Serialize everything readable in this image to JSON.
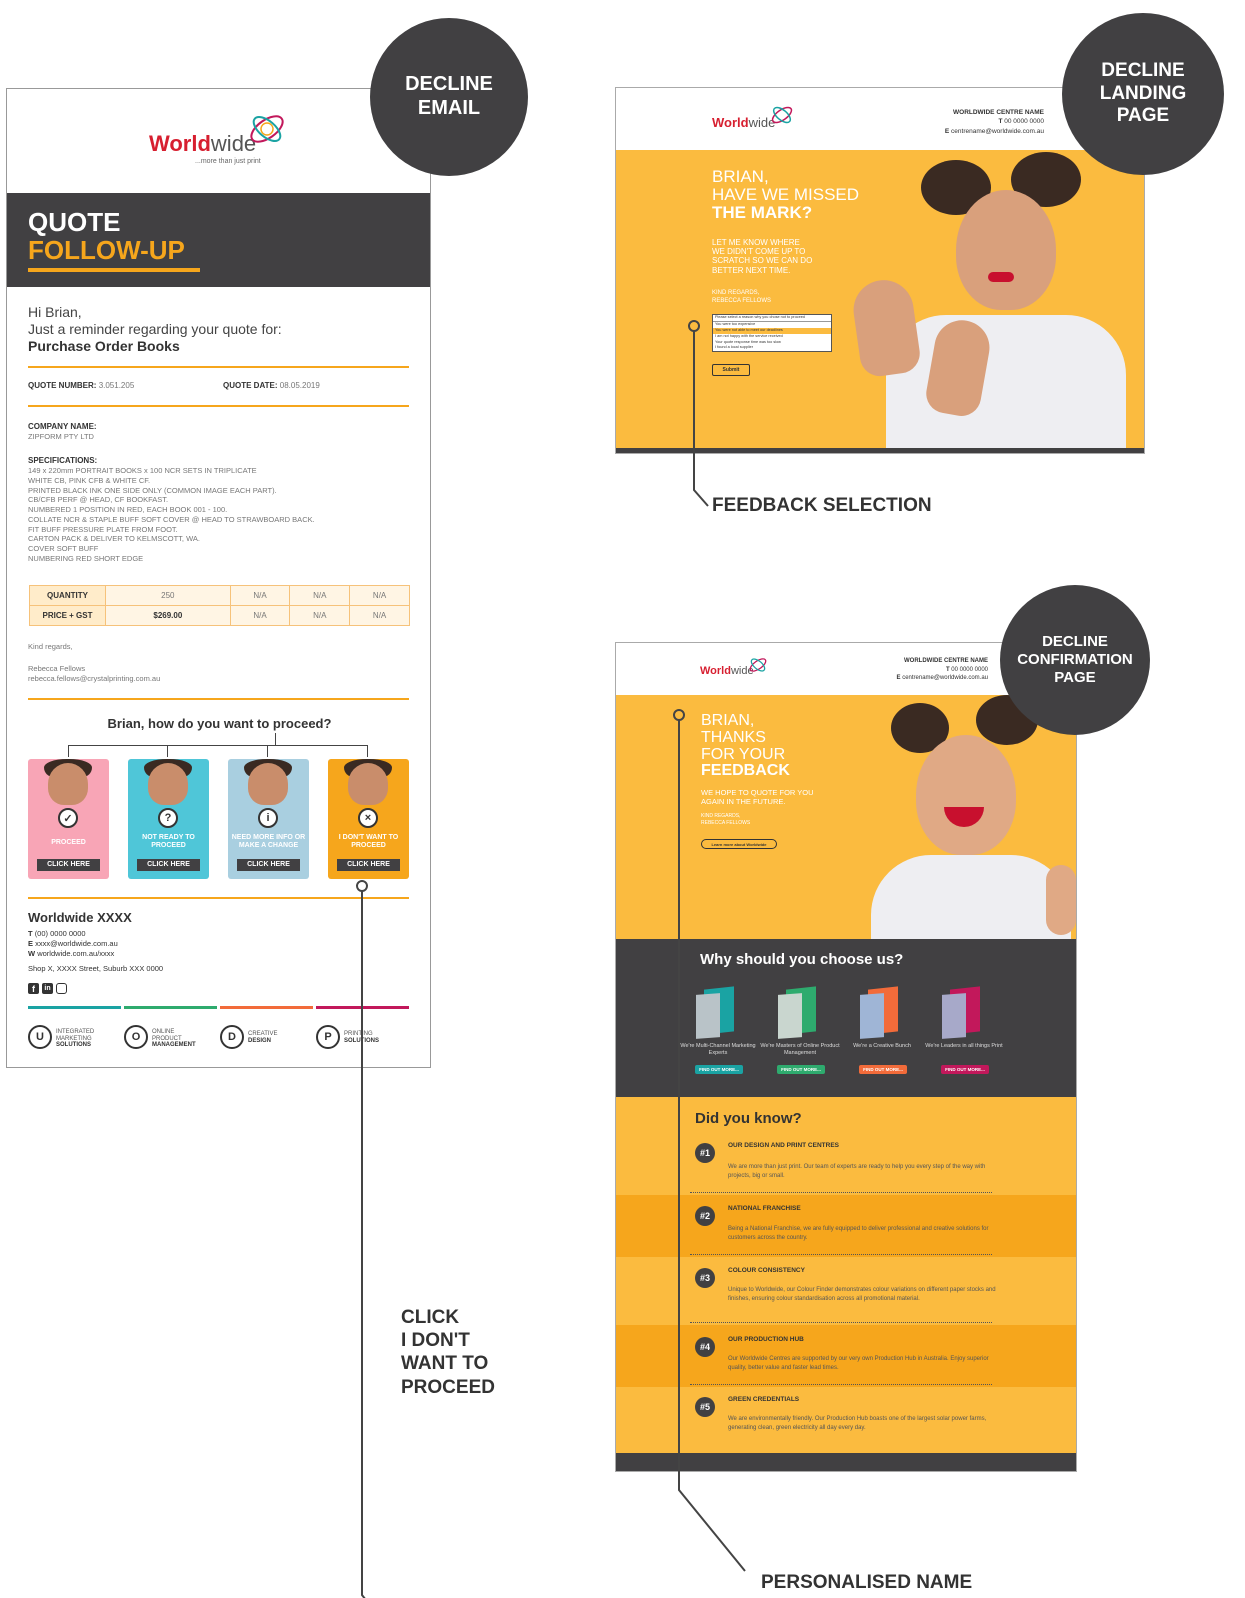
{
  "badges": {
    "email": [
      "DECLINE",
      "EMAIL"
    ],
    "landing": [
      "DECLINE",
      "LANDING",
      "PAGE"
    ],
    "confirm": [
      "DECLINE",
      "CONFIRMATION",
      "PAGE"
    ]
  },
  "callouts": {
    "feedback": "FEEDBACK SELECTION",
    "click": [
      "CLICK",
      "I DON'T",
      "WANT TO",
      "PROCEED"
    ],
    "name": "PERSONALISED NAME"
  },
  "logo": {
    "part1": "World",
    "part2": "wide",
    "tagline": "...more than just print"
  },
  "email": {
    "title1": "QUOTE",
    "title2": "FOLLOW-UP",
    "greeting": "Hi Brian,",
    "reminder": "Just a reminder regarding your quote for:",
    "product": "Purchase Order Books",
    "quote_number_label": "QUOTE NUMBER:",
    "quote_number": "3.051.205",
    "quote_date_label": "QUOTE DATE:",
    "quote_date": "08.05.2019",
    "company_label": "COMPANY NAME:",
    "company": "ZIPFORM PTY LTD",
    "spec_label": "SPECIFICATIONS:",
    "specs": [
      "149 x 220mm PORTRAIT BOOKS x 100 NCR SETS IN TRIPLICATE",
      "WHITE CB, PINK CFB & WHITE CF.",
      "PRINTED BLACK INK ONE SIDE ONLY (COMMON IMAGE EACH PART).",
      "CB/CFB PERF @ HEAD, CF BOOKFAST.",
      "NUMBERED 1 POSITION IN RED, EACH BOOK 001 - 100.",
      "COLLATE NCR & STAPLE BUFF SOFT COVER @ HEAD TO STRAWBOARD BACK.",
      "FIT BUFF PRESSURE PLATE FROM FOOT.",
      "CARTON PACK & DELIVER TO KELMSCOTT, WA.",
      "COVER SOFT BUFF",
      "NUMBERING RED SHORT EDGE"
    ],
    "table": {
      "rows": [
        {
          "label": "QUANTITY",
          "cells": [
            "250",
            "N/A",
            "N/A",
            "N/A"
          ]
        },
        {
          "label": "PRICE + GST",
          "cells": [
            "$269.00",
            "N/A",
            "N/A",
            "N/A"
          ]
        }
      ]
    },
    "kind_regards": "Kind regards,",
    "sender": "Rebecca Fellows",
    "sender_email": "rebecca.fellows@crystalprinting.com.au",
    "question": "Brian, how do you want to proceed?",
    "cards": [
      {
        "label": "PROCEED",
        "button": "CLICK HERE",
        "color": "#f8a5b6",
        "icon": "✓"
      },
      {
        "label": "NOT READY TO PROCEED",
        "button": "CLICK HERE",
        "color": "#4fc6d8",
        "icon": "?"
      },
      {
        "label": "NEED MORE INFO OR MAKE A CHANGE",
        "button": "CLICK HERE",
        "color": "#a9cfe0",
        "icon": "i"
      },
      {
        "label": "I DON'T WANT TO PROCEED",
        "button": "CLICK HERE",
        "color": "#f6a61c",
        "icon": "×"
      }
    ],
    "footer_name": "Worldwide XXXX",
    "phone_label": "T",
    "phone": "(00) 0000 0000",
    "email_label": "E",
    "email_val": "xxxx@worldwide.com.au",
    "web_label": "W",
    "web": "worldwide.com.au/xxxx",
    "address": "Shop X, XXXX Street, Suburb XXX 0000",
    "stripe_colors": [
      "#1aa3a3",
      "#2eab6e",
      "#f26b3a",
      "#c2185b"
    ],
    "services": [
      {
        "letter": "U",
        "l1": "INTEGRATED",
        "l2": "MARKETING",
        "l3": "SOLUTIONS"
      },
      {
        "letter": "O",
        "l1": "ONLINE",
        "l2": "PRODUCT",
        "l3": "MANAGEMENT"
      },
      {
        "letter": "D",
        "l1": "CREATIVE",
        "l2": "DESIGN",
        "l3": ""
      },
      {
        "letter": "P",
        "l1": "PRINTING",
        "l2": "SOLUTIONS",
        "l3": ""
      }
    ]
  },
  "landing": {
    "centre_name": "WORLDWIDE CENTRE NAME",
    "phone_label": "T",
    "phone": "00 0000 0000",
    "email_label": "E",
    "email": "centrename@worldwide.com.au",
    "h1": "BRIAN,",
    "h2": "HAVE WE MISSED",
    "h3": "THE MARK?",
    "body": [
      "LET ME KNOW WHERE",
      "WE DIDN'T COME UP TO",
      "SCRATCH SO WE CAN DO",
      "BETTER NEXT TIME."
    ],
    "regards": "KIND REGARDS,",
    "sender": "REBECCA FELLOWS",
    "options": [
      "Please select a reason why you chose not to proceed",
      "You were too expensive",
      "You were not able to meet our deadlines",
      "I am not happy with the service received",
      "Your quote response time was too slow",
      "I found a local supplier"
    ],
    "submit": "Submit"
  },
  "confirm": {
    "centre_name": "WORLDWIDE CENTRE NAME",
    "phone_label": "T",
    "phone": "00 0000 0000",
    "email_label": "E",
    "email": "centrename@worldwide.com.au",
    "h1": "BRIAN,",
    "h2": "THANKS",
    "h3": "FOR YOUR",
    "h4": "FEEDBACK",
    "body": [
      "WE HOPE TO QUOTE FOR YOU",
      "AGAIN IN THE FUTURE."
    ],
    "regards": "KIND REGARDS,",
    "sender": "REBECCA FELLOWS",
    "learn_btn": "Learn more about Worldwide",
    "why_title": "Why should you choose us?",
    "features": [
      {
        "text": "We're Multi-Channel Marketing Experts",
        "btn": "FIND OUT MORE...",
        "color": "#1aa3a3"
      },
      {
        "text": "We're Masters of Online Product Management",
        "btn": "FIND OUT MORE...",
        "color": "#2eab6e"
      },
      {
        "text": "We're a Creative Bunch",
        "btn": "FIND OUT MORE...",
        "color": "#f26b3a"
      },
      {
        "text": "We're Leaders in all things Print",
        "btn": "FIND OUT MORE...",
        "color": "#c2185b"
      }
    ],
    "dyk_title": "Did you know?",
    "facts": [
      {
        "num": "#1",
        "title": "OUR DESIGN AND PRINT CENTRES",
        "body": "We are more than just print. Our team of experts are ready to help you every step of the way with projects, big or small."
      },
      {
        "num": "#2",
        "title": "NATIONAL FRANCHISE",
        "body": "Being a National Franchise, we are fully equipped to deliver professional and creative solutions for customers across the country."
      },
      {
        "num": "#3",
        "title": "COLOUR CONSISTENCY",
        "body": "Unique to Worldwide, our Colour Finder demonstrates colour variations on different paper stocks and finishes, ensuring colour standardisation across all promotional material."
      },
      {
        "num": "#4",
        "title": "OUR PRODUCTION HUB",
        "body": "Our Worldwide Centres are supported by our very own Production Hub in Australia. Enjoy superior quality, better value and faster lead times."
      },
      {
        "num": "#5",
        "title": "GREEN CREDENTIALS",
        "body": "We are environmentally friendly. Our Production Hub boasts one of the largest solar power farms, generating clean, green electricity all day every day."
      }
    ]
  }
}
